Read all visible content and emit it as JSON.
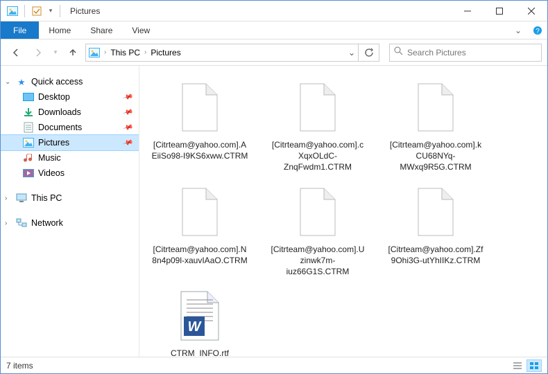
{
  "window": {
    "title": "Pictures"
  },
  "ribbon": {
    "file": "File",
    "tabs": [
      "Home",
      "Share",
      "View"
    ]
  },
  "breadcrumb": {
    "items": [
      "This PC",
      "Pictures"
    ],
    "dropdown_label": ""
  },
  "search": {
    "placeholder": "Search Pictures"
  },
  "sidebar": {
    "quick_access": {
      "label": "Quick access",
      "items": [
        {
          "label": "Desktop",
          "icon": "desktop",
          "pinned": true
        },
        {
          "label": "Downloads",
          "icon": "downloads",
          "pinned": true
        },
        {
          "label": "Documents",
          "icon": "documents",
          "pinned": true
        },
        {
          "label": "Pictures",
          "icon": "pictures",
          "pinned": true,
          "selected": true
        },
        {
          "label": "Music",
          "icon": "music",
          "pinned": false
        },
        {
          "label": "Videos",
          "icon": "videos",
          "pinned": false
        }
      ]
    },
    "this_pc": {
      "label": "This PC"
    },
    "network": {
      "label": "Network"
    }
  },
  "files": [
    {
      "name": "[Citrteam@yahoo.com].AEiiSo98-I9KS6xww.CTRM",
      "type": "blank"
    },
    {
      "name": "[Citrteam@yahoo.com].cXqxOLdC-ZnqFwdm1.CTRM",
      "type": "blank"
    },
    {
      "name": "[Citrteam@yahoo.com].kCU68NYq-MWxq9R5G.CTRM",
      "type": "blank"
    },
    {
      "name": "[Citrteam@yahoo.com].N8n4p09l-xauvIAaO.CTRM",
      "type": "blank"
    },
    {
      "name": "[Citrteam@yahoo.com].Uzinwk7m-iuz66G1S.CTRM",
      "type": "blank"
    },
    {
      "name": "[Citrteam@yahoo.com].Zf9Ohi3G-utYhIIKz.CTRM",
      "type": "blank"
    },
    {
      "name": "CTRM_INFO.rtf",
      "type": "rtf"
    }
  ],
  "status": {
    "count_label": "7 items"
  },
  "icons": {
    "pictures_tb": "pictures-icon",
    "qat_props": "props-icon",
    "qat_dd": "dropdown-icon"
  }
}
